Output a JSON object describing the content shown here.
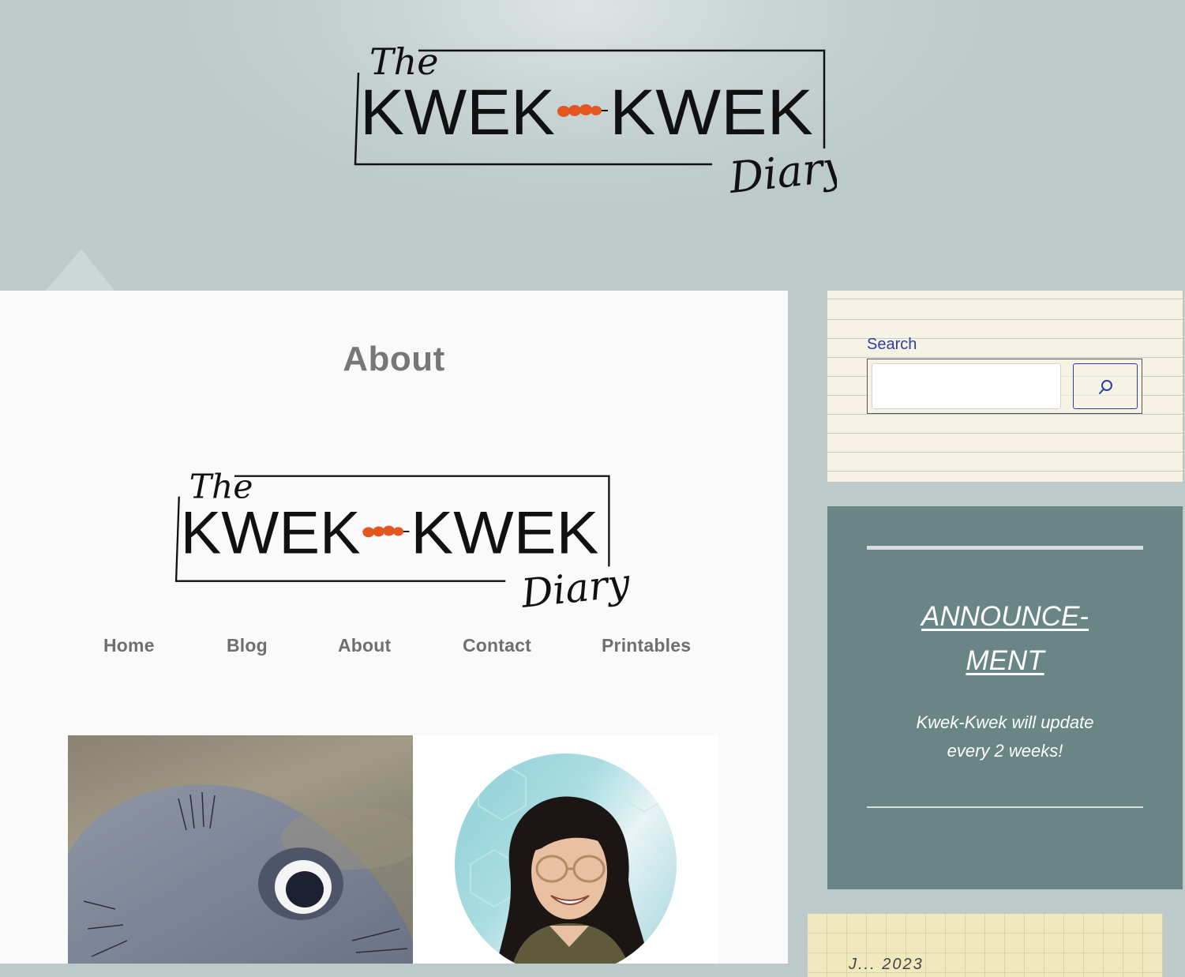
{
  "site": {
    "logo": {
      "line1": "The",
      "line2_left": "KWEK",
      "line2_right": "KWEK",
      "line3": "Diary"
    }
  },
  "page": {
    "title": "About"
  },
  "nav": {
    "items": [
      {
        "label": "Home"
      },
      {
        "label": "Blog"
      },
      {
        "label": "About"
      },
      {
        "label": "Contact"
      },
      {
        "label": "Printables"
      }
    ]
  },
  "sidebar": {
    "search": {
      "label": "Search",
      "value": "",
      "placeholder": "",
      "button_icon": "search-icon"
    },
    "announcement": {
      "heading_line1": "ANNOUNCE-",
      "heading_line2": "MENT",
      "body_line1": "Kwek-Kwek will update",
      "body_line2": "every 2 weeks!"
    },
    "calendar": {
      "caption": "J...  2023"
    }
  },
  "colors": {
    "background": "#bccaca",
    "content_bg": "#fafafa",
    "nav_text": "#6f6f6f",
    "search_accent": "#2f3fa0",
    "announcement_bg": "#698585",
    "notepad_bg": "#f6f2e4",
    "calendar_bg": "#f0e9bd",
    "skewer_orange": "#e2561f"
  }
}
